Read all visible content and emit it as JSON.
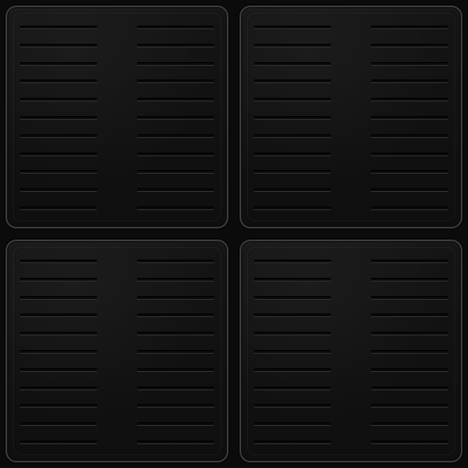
{
  "texture": {
    "panel_count": 4,
    "grilles_per_panel": 2,
    "slots_per_grille": 11
  },
  "colors": {
    "background": "#0b0b0b",
    "panel_fill": "#131313",
    "panel_border": "#3a3a3a",
    "slot_dark": "#0a0a0a",
    "slot_highlight": "#2f2f2f"
  },
  "panels": [
    {
      "name": "panel-top-left"
    },
    {
      "name": "panel-top-right"
    },
    {
      "name": "panel-bottom-left"
    },
    {
      "name": "panel-bottom-right"
    }
  ]
}
